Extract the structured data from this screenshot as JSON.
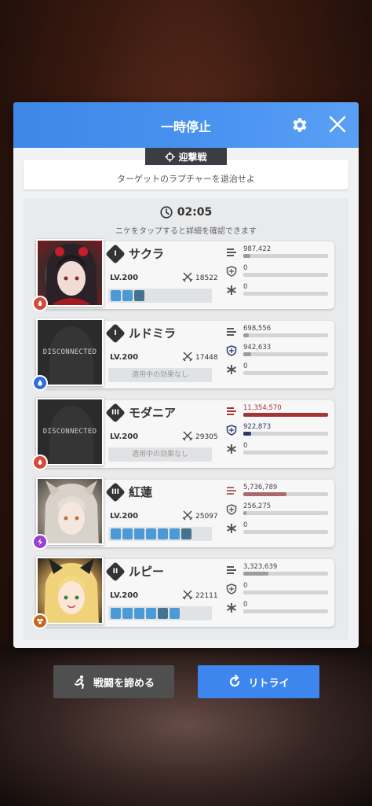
{
  "dialog": {
    "title": "一時停止",
    "mode_tag": "迎撃戦",
    "objective": "ターゲットのラプチャーを退治せよ",
    "timer": "02:05",
    "hint": "ニケをタップすると詳細を確認できます"
  },
  "characters": [
    {
      "name": "サクラ",
      "burst": "I",
      "level": "LV.200",
      "atk": "18522",
      "connected": true,
      "element_color": "#d64a3a",
      "damage": "987,422",
      "damage_fill": 0.08,
      "damage_color": "#9a9ca0",
      "shield": "0",
      "shield_fill": 0.0,
      "heal": "0",
      "heal_fill": 0.0,
      "buffs_label": "",
      "buff_count": 3
    },
    {
      "name": "ルドミラ",
      "burst": "I",
      "level": "LV.200",
      "atk": "17448",
      "connected": false,
      "disconnected_label": "DISCONNECTED",
      "element_color": "#2f6fd6",
      "damage": "698,556",
      "damage_fill": 0.06,
      "damage_color": "#9a9ca0",
      "shield": "942,633",
      "shield_fill": 0.09,
      "shield_color": "#9a9ca0",
      "heal": "0",
      "heal_fill": 0.0,
      "buffs_label": "適用中の効果なし"
    },
    {
      "name": "モダニア",
      "burst": "III",
      "level": "LV.200",
      "atk": "29305",
      "connected": false,
      "disconnected_label": "DISCONNECTED",
      "element_color": "#d64a3a",
      "damage": "11,354,570",
      "damage_fill": 1.0,
      "damage_color": "#a23636",
      "shield": "922,873",
      "shield_fill": 0.09,
      "shield_color": "#2e3a64",
      "heal": "0",
      "heal_fill": 0.0,
      "buffs_label": "適用中の効果なし"
    },
    {
      "name": "紅蓮",
      "burst": "III",
      "level": "LV.200",
      "atk": "25097",
      "connected": true,
      "element_color": "#9a3fd0",
      "damage": "5,736,789",
      "damage_fill": 0.51,
      "damage_color": "#a86a6a",
      "shield": "256,275",
      "shield_fill": 0.03,
      "shield_color": "#9a9ca0",
      "heal": "0",
      "heal_fill": 0.0,
      "buffs_label": "",
      "buff_count": 7
    },
    {
      "name": "ルピー",
      "burst": "II",
      "level": "LV.200",
      "atk": "22111",
      "connected": true,
      "element_color": "#c46a20",
      "damage": "3,323,639",
      "damage_fill": 0.29,
      "damage_color": "#9a9ca0",
      "shield": "0",
      "shield_fill": 0.0,
      "heal": "0",
      "heal_fill": 0.0,
      "buffs_label": "",
      "buff_count": 6
    }
  ],
  "buttons": {
    "give_up": "戦闘を諦める",
    "retry": "リトライ"
  },
  "colors": {
    "header_blue": "#4a93f0",
    "retry_blue": "#3d86ee",
    "giveup_gray": "#4f4f4f"
  },
  "icons": [
    "gear-icon",
    "close-icon",
    "crosshair-icon",
    "clock-icon",
    "running-icon",
    "retry-icon",
    "damage-icon",
    "shield-icon",
    "heal-icon",
    "attack-icon"
  ]
}
